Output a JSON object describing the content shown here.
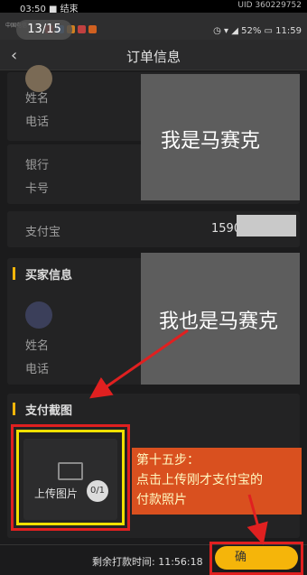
{
  "recording": {
    "time": "03:50",
    "status": "结束",
    "uid": "UID 360229752"
  },
  "status_bar": {
    "carrier": "中国电信",
    "battery": "52%",
    "clock": "11:59"
  },
  "image_counter": "13/15",
  "nav": {
    "title": "订单信息"
  },
  "seller_card": {
    "name_label": "姓名",
    "phone_label": "电话",
    "bank_label": "银行",
    "card_label": "卡号",
    "mosaic_text": "我是马赛克"
  },
  "alipay": {
    "label": "支付宝",
    "value": "1590"
  },
  "buyer": {
    "section_title": "买家信息",
    "name_label": "姓名",
    "phone_label": "电话",
    "mosaic_text": "我也是马赛克"
  },
  "payment": {
    "section_title": "支付截图",
    "upload_label": "上传图片",
    "upload_count": "0/1"
  },
  "annotation": {
    "line1": "第十五步：",
    "line2": "点击上传刚才支付宝的",
    "line3": "付款照片"
  },
  "bottom": {
    "countdown_label": "剩余打款时间:",
    "countdown_value": "11:56:18",
    "confirm_label": "确"
  },
  "colors": {
    "accent": "#f5b50a",
    "highlight": "#e02020",
    "callout": "#d9501f"
  }
}
